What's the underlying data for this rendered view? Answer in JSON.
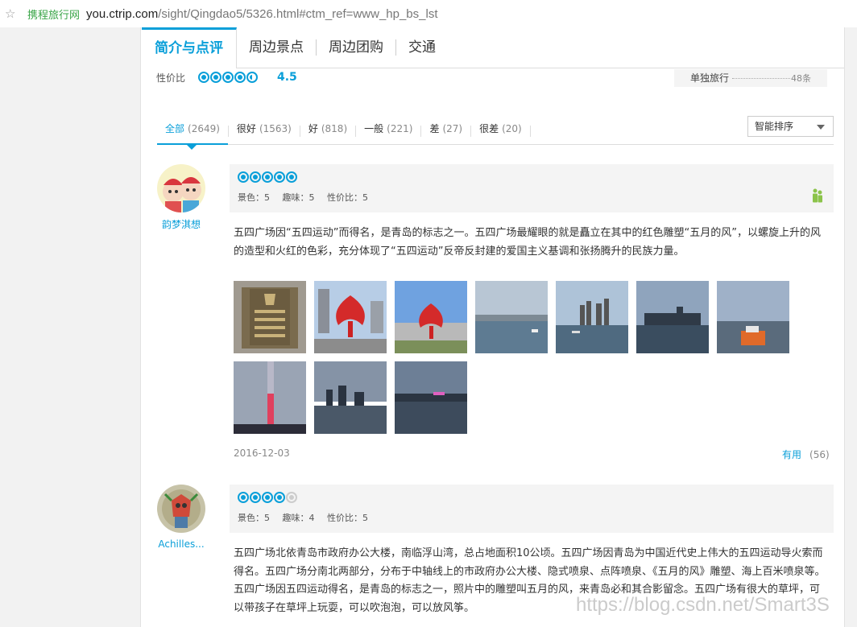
{
  "browser": {
    "site_label": "携程旅行网",
    "url_main": "you.ctrip.com",
    "url_path": "/sight/Qingdao5/5326.html#ctm_ref=www_hp_bs_lst"
  },
  "tabs": [
    {
      "label": "简介与点评",
      "active": true
    },
    {
      "label": "周边景点"
    },
    {
      "label": "周边团购"
    },
    {
      "label": "交通"
    }
  ],
  "summary": {
    "label": "性价比",
    "score": "4.5",
    "rating_value": 4.5,
    "travel_label": "单独旅行",
    "travel_count": "48条"
  },
  "filters": [
    {
      "label": "全部",
      "count": "(2649)",
      "active": true
    },
    {
      "label": "很好",
      "count": "(1563)"
    },
    {
      "label": "好",
      "count": "(818)"
    },
    {
      "label": "一般",
      "count": "(221)"
    },
    {
      "label": "差",
      "count": "(27)"
    },
    {
      "label": "很差",
      "count": "(20)"
    }
  ],
  "sort": {
    "selected": "智能排序"
  },
  "reviews": [
    {
      "user": "韵梦淇想",
      "rating": 5,
      "scores": {
        "scenery": "景色：5",
        "fun": "趣味：5",
        "value": "性价比：5"
      },
      "text": "五四广场因“五四运动”而得名，是青岛的标志之一。五四广场最耀眼的就是矗立在其中的红色雕塑“五月的风”，以螺旋上升的风的造型和火红的色彩，充分体现了“五四运动”反帝反封建的爱国主义基调和张扬腾升的民族力量。",
      "photo_count": 10,
      "date": "2016-12-03",
      "useful_label": "有用",
      "useful_count": "(56)"
    },
    {
      "user": "Achilles...",
      "rating": 4,
      "scores": {
        "scenery": "景色：5",
        "fun": "趣味：4",
        "value": "性价比：5"
      },
      "text": "五四广场北依青岛市政府办公大楼，南临浮山湾，总占地面积10公顷。五四广场因青岛为中国近代史上伟大的五四运动导火索而得名。五四广场分南北两部分，分布于中轴线上的市政府办公大楼、隐式喷泉、点阵喷泉、《五月的风》雕塑、海上百米喷泉等。五四广场因五四运动得名，是青岛的标志之一，照片中的雕塑叫五月的风，来青岛必和其合影留念。五四广场有很大的草坪，可以带孩子在草坪上玩耍，可以吹泡泡，可以放风筝。"
    }
  ],
  "watermark": "https://blog.csdn.net/Smart3S"
}
